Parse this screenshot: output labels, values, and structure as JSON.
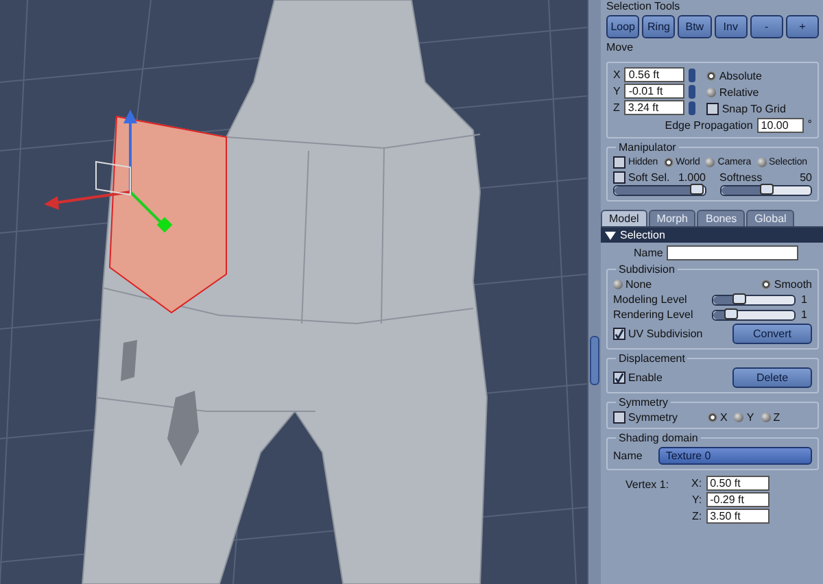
{
  "selection_tools": {
    "title": "Selection Tools",
    "buttons": [
      "Loop",
      "Ring",
      "Btw",
      "Inv",
      "-",
      "+"
    ]
  },
  "move": {
    "title": "Move",
    "fields": [
      {
        "axis": "X",
        "value": "0.56 ft"
      },
      {
        "axis": "Y",
        "value": "-0.01 ft"
      },
      {
        "axis": "Z",
        "value": "3.24 ft"
      }
    ],
    "modes": [
      {
        "label": "Absolute",
        "selected": true
      },
      {
        "label": "Relative",
        "selected": false
      }
    ],
    "snap_to_grid": {
      "label": "Snap To Grid",
      "checked": false
    },
    "edge_propagation": {
      "label": "Edge Propagation",
      "value": "10.00",
      "unit": "°"
    }
  },
  "manipulator": {
    "title": "Manipulator",
    "hidden": {
      "label": "Hidden",
      "checked": false
    },
    "spaces": [
      {
        "label": "World",
        "selected": true
      },
      {
        "label": "Camera",
        "selected": false
      },
      {
        "label": "Selection",
        "selected": false
      }
    ],
    "soft_sel": {
      "label": "Soft Sel.",
      "checked": false,
      "reading": "1.000",
      "level": 0.9
    },
    "softness": {
      "label": "Softness",
      "reading": "50",
      "level": 0.5
    }
  },
  "tabs": [
    {
      "label": "Model",
      "selected": true
    },
    {
      "label": "Morph",
      "selected": false
    },
    {
      "label": "Bones",
      "selected": false
    },
    {
      "label": "Global",
      "selected": false
    }
  ],
  "selection": {
    "title": "Selection",
    "expanded": true,
    "name_label": "Name"
  },
  "subdivision": {
    "title": "Subdivision",
    "modes": [
      {
        "label": "None",
        "selected": false
      },
      {
        "label": "Smooth",
        "selected": true
      }
    ],
    "levels": [
      {
        "label": "Modeling Level",
        "level": 0.3,
        "reading": "1"
      },
      {
        "label": "Rendering Level",
        "level": 0.2,
        "reading": "1"
      }
    ],
    "uv": {
      "label": "UV Subdivision",
      "checked": true
    },
    "button": "Convert"
  },
  "displacement": {
    "title": "Displacement",
    "enable": {
      "label": "Enable",
      "checked": true
    },
    "button": "Delete"
  },
  "symmetry": {
    "title": "Symmetry",
    "checkbox": {
      "label": "Symmetry",
      "checked": false
    },
    "axes": [
      {
        "label": "X",
        "selected": true
      },
      {
        "label": "Y",
        "selected": false
      },
      {
        "label": "Z",
        "selected": false
      }
    ]
  },
  "shading_domain": {
    "title": "Shading domain",
    "name_label": "Name",
    "value": "Texture 0"
  },
  "vertex": {
    "label": "Vertex 1:",
    "fields": [
      {
        "axis": "X:",
        "value": "0.50 ft"
      },
      {
        "axis": "Y:",
        "value": "-0.29 ft"
      },
      {
        "axis": "Z:",
        "value": "3.50 ft"
      }
    ]
  }
}
